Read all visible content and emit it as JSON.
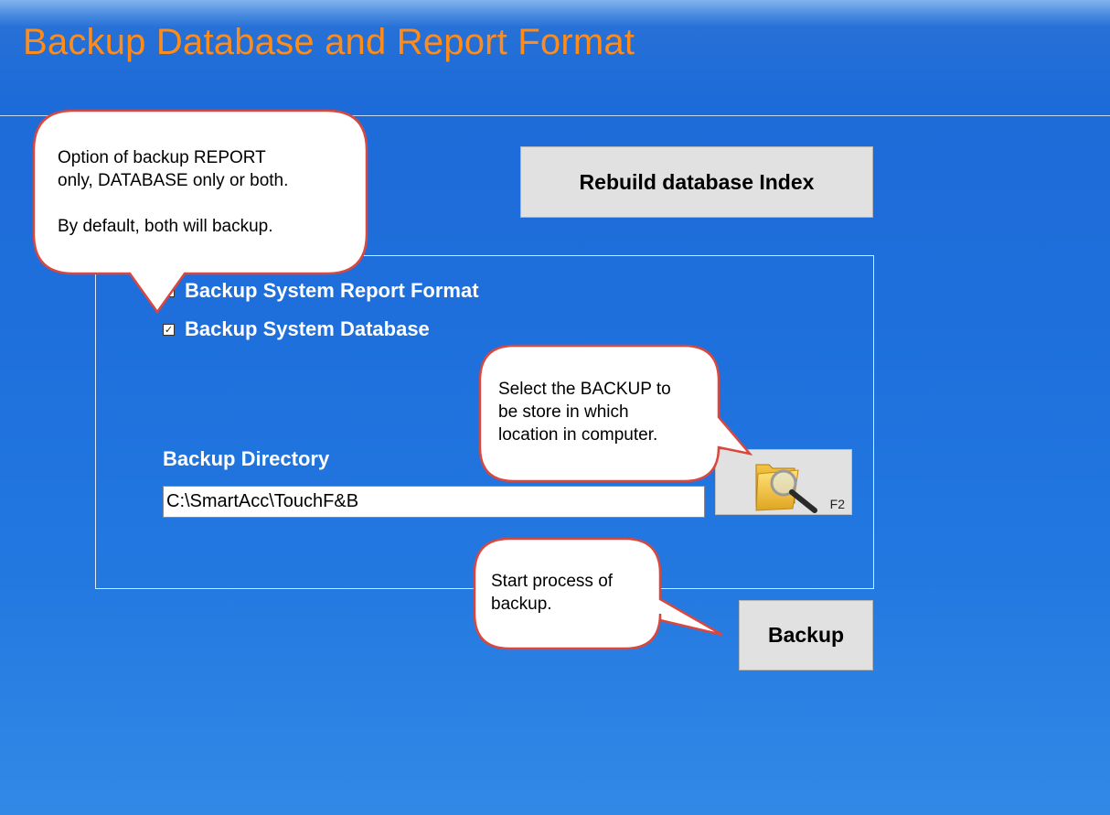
{
  "page": {
    "title": "Backup Database and Report Format"
  },
  "buttons": {
    "rebuild_index": "Rebuild database Index",
    "backup": "Backup",
    "browse_shortcut": "F2"
  },
  "options": {
    "backup_report_format": {
      "label": "Backup System Report Format",
      "checked": true
    },
    "backup_database": {
      "label": "Backup System Database",
      "checked": true
    }
  },
  "directory": {
    "label": "Backup Directory",
    "value": "C:\\SmartAcc\\TouchF&B"
  },
  "callouts": {
    "backup_options": "Option of backup REPORT\nonly, DATABASE only or both.\n\nBy default, both will backup.",
    "backup_location": "Select the BACKUP to\nbe store in which\nlocation in computer.",
    "start_backup": "Start process of\nbackup."
  },
  "icons": {
    "browse": "folder-search-icon",
    "checkbox_checked": "checkmark-icon"
  },
  "colors": {
    "title": "#ff8c1a",
    "background": "#1e6fdc",
    "callout_border": "#d9473f",
    "button_face": "#e1e1e1"
  }
}
